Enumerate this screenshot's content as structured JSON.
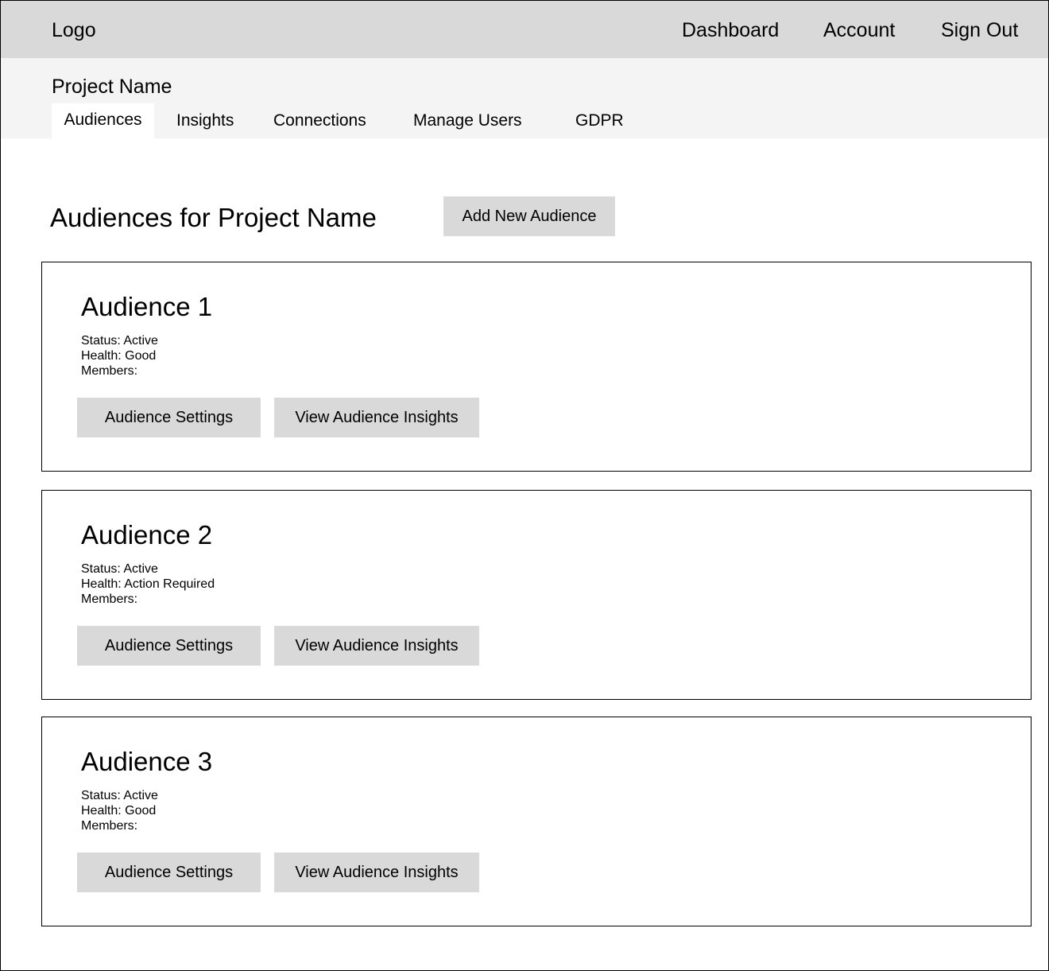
{
  "header": {
    "logo": "Logo",
    "nav": [
      "Dashboard",
      "Account",
      "Sign Out"
    ]
  },
  "project": {
    "name": "Project Name",
    "tabs": [
      "Audiences",
      "Insights",
      "Connections",
      "Manage Users",
      "GDPR"
    ],
    "active_tab": "Audiences"
  },
  "main": {
    "title": "Audiences for Project Name",
    "add_button": "Add New Audience"
  },
  "audiences": [
    {
      "name": "Audience 1",
      "status": "Status: Active",
      "health": "Health: Good",
      "members": "Members:",
      "settings_label": "Audience Settings",
      "insights_label": "View Audience Insights"
    },
    {
      "name": "Audience 2",
      "status": "Status: Active",
      "health": "Health: Action Required",
      "members": "Members:",
      "settings_label": "Audience Settings",
      "insights_label": "View Audience Insights"
    },
    {
      "name": "Audience 3",
      "status": "Status: Active",
      "health": "Health: Good",
      "members": "Members:",
      "settings_label": "Audience Settings",
      "insights_label": "View Audience Insights"
    }
  ],
  "colors": {
    "topbar": "#d9d9d9",
    "subbar": "#f4f4f4",
    "button": "#d9d9d9",
    "border": "#000000"
  }
}
